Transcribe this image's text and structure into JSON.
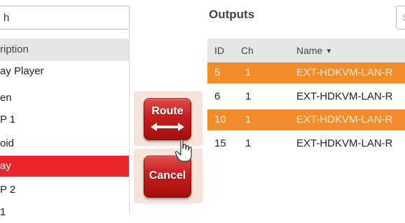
{
  "inputs": {
    "search_value": "h",
    "header_description": "ription",
    "rows": [
      {
        "label": "ay Player",
        "selected": false
      },
      {
        "label": "en",
        "selected": false
      },
      {
        "label": "P 1",
        "selected": false
      },
      {
        "label": "oid",
        "selected": false
      },
      {
        "label": "ay",
        "selected": true
      },
      {
        "label": "P 2",
        "selected": false
      },
      {
        "label": "1",
        "selected": false
      }
    ]
  },
  "actions": {
    "route_label": "Route",
    "cancel_label": "Cancel"
  },
  "outputs": {
    "title": "Outputs",
    "search_value": "S",
    "columns": {
      "id": "ID",
      "ch": "Ch",
      "name": "Name"
    },
    "rows": [
      {
        "id": "5",
        "ch": "1",
        "name": "EXT-HDKVM-LAN-R",
        "selected": true
      },
      {
        "id": "6",
        "ch": "1",
        "name": "EXT-HDKVM-LAN-R",
        "selected": false
      },
      {
        "id": "10",
        "ch": "1",
        "name": "EXT-HDKVM-LAN-R",
        "selected": true
      },
      {
        "id": "15",
        "ch": "1",
        "name": "EXT-HDKVM-LAN-R",
        "selected": false
      }
    ]
  },
  "colors": {
    "selected_input": "#e8242c",
    "selected_output": "#f28c2b",
    "button": "#c31d1d"
  },
  "icons": {
    "route": "double-arrow-icon",
    "cursor": "hand-pointer-icon"
  }
}
